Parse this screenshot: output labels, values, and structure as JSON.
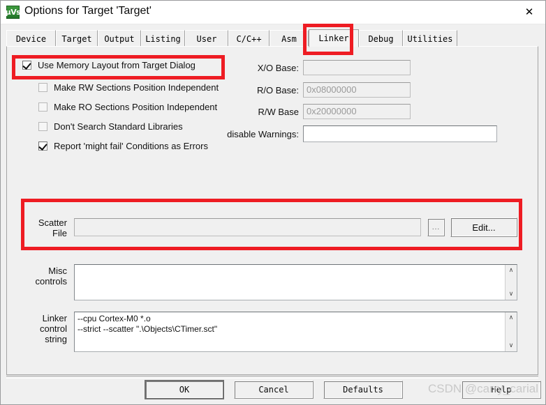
{
  "window": {
    "title": "Options for Target 'Target'",
    "icon_name": "keil-uvision-icon",
    "icon_glyph": "µVs",
    "close_glyph": "✕"
  },
  "tabs": [
    {
      "label": "Device",
      "active": false
    },
    {
      "label": "Target",
      "active": false
    },
    {
      "label": "Output",
      "active": false
    },
    {
      "label": "Listing",
      "active": false
    },
    {
      "label": "User",
      "active": false
    },
    {
      "label": "C/C++",
      "active": false
    },
    {
      "label": "Asm",
      "active": false
    },
    {
      "label": "Linker",
      "active": true
    },
    {
      "label": "Debug",
      "active": false
    },
    {
      "label": "Utilities",
      "active": false
    }
  ],
  "checkboxes": [
    {
      "label": "Use Memory Layout from Target Dialog",
      "checked": true
    },
    {
      "label": "Make RW Sections Position Independent",
      "checked": false
    },
    {
      "label": "Make RO Sections Position Independent",
      "checked": false
    },
    {
      "label": "Don't Search Standard Libraries",
      "checked": false
    },
    {
      "label": "Report 'might fail' Conditions as Errors",
      "checked": true
    }
  ],
  "fields": {
    "xo_base": {
      "label": "X/O Base:",
      "value": "",
      "disabled": true
    },
    "ro_base": {
      "label": "R/O Base:",
      "value": "0x08000000",
      "disabled": true
    },
    "rw_base": {
      "label": "R/W Base",
      "value": "0x20000000",
      "disabled": true
    },
    "disable_warnings": {
      "label": "disable Warnings:",
      "value": "",
      "disabled": false
    }
  },
  "scatter": {
    "label_line1": "Scatter",
    "label_line2": "File",
    "value": "",
    "browse_label": "...",
    "edit_label": "Edit..."
  },
  "misc": {
    "label_line1": "Misc",
    "label_line2": "controls",
    "value": ""
  },
  "linker_control": {
    "label_line1": "Linker",
    "label_line2": "control",
    "label_line3": "string",
    "value": "--cpu Cortex-M0 *.o\n--strict --scatter \".\\Objects\\CTimer.sct\""
  },
  "scrollbar": {
    "up_glyph": "∧",
    "down_glyph": "∨"
  },
  "buttons": {
    "ok": "OK",
    "cancel": "Cancel",
    "defaults": "Defaults",
    "help": "Help"
  },
  "watermark": "CSDN @carry_carial",
  "colors": {
    "annotation_red": "#ee1c23",
    "dialog_face": "#f0f0f0",
    "title_bar": "#ffffff",
    "disabled_text": "#9a9a9a"
  }
}
